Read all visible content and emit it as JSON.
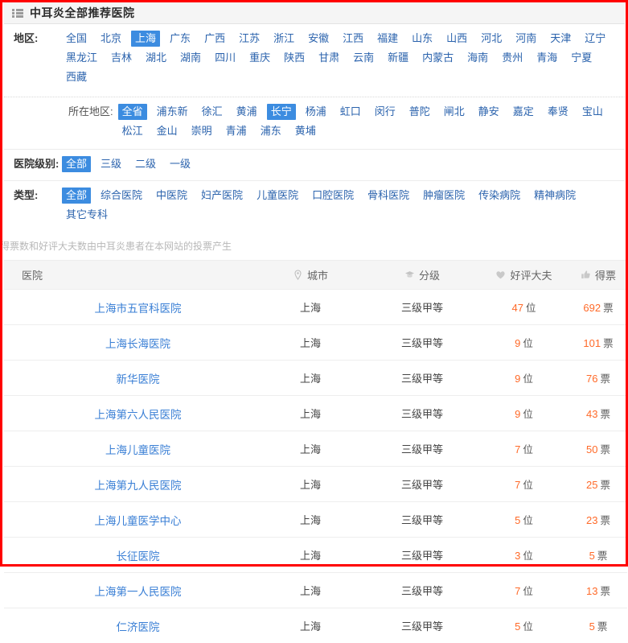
{
  "header": {
    "title": "中耳炎全部推荐医院",
    "icon": "list-icon"
  },
  "filters": {
    "region": {
      "label": "地区:",
      "options": [
        {
          "text": "全国",
          "active": false
        },
        {
          "text": "北京",
          "active": false
        },
        {
          "text": "上海",
          "active": true
        },
        {
          "text": "广东",
          "active": false
        },
        {
          "text": "广西",
          "active": false
        },
        {
          "text": "江苏",
          "active": false
        },
        {
          "text": "浙江",
          "active": false
        },
        {
          "text": "安徽",
          "active": false
        },
        {
          "text": "江西",
          "active": false
        },
        {
          "text": "福建",
          "active": false
        },
        {
          "text": "山东",
          "active": false
        },
        {
          "text": "山西",
          "active": false
        },
        {
          "text": "河北",
          "active": false
        },
        {
          "text": "河南",
          "active": false
        },
        {
          "text": "天津",
          "active": false
        },
        {
          "text": "辽宁",
          "active": false
        },
        {
          "text": "黑龙江",
          "active": false
        },
        {
          "text": "吉林",
          "active": false
        },
        {
          "text": "湖北",
          "active": false
        },
        {
          "text": "湖南",
          "active": false
        },
        {
          "text": "四川",
          "active": false
        },
        {
          "text": "重庆",
          "active": false
        },
        {
          "text": "陕西",
          "active": false
        },
        {
          "text": "甘肃",
          "active": false
        },
        {
          "text": "云南",
          "active": false
        },
        {
          "text": "新疆",
          "active": false
        },
        {
          "text": "内蒙古",
          "active": false
        },
        {
          "text": "海南",
          "active": false
        },
        {
          "text": "贵州",
          "active": false
        },
        {
          "text": "青海",
          "active": false
        },
        {
          "text": "宁夏",
          "active": false
        },
        {
          "text": "西藏",
          "active": false
        }
      ]
    },
    "district": {
      "label": "所在地区:",
      "options": [
        {
          "text": "全省",
          "active": true
        },
        {
          "text": "浦东新",
          "active": false
        },
        {
          "text": "徐汇",
          "active": false
        },
        {
          "text": "黄浦",
          "active": false
        },
        {
          "text": "长宁",
          "active": true
        },
        {
          "text": "杨浦",
          "active": false
        },
        {
          "text": "虹口",
          "active": false
        },
        {
          "text": "闵行",
          "active": false
        },
        {
          "text": "普陀",
          "active": false
        },
        {
          "text": "闸北",
          "active": false
        },
        {
          "text": "静安",
          "active": false
        },
        {
          "text": "嘉定",
          "active": false
        },
        {
          "text": "奉贤",
          "active": false
        },
        {
          "text": "宝山",
          "active": false
        },
        {
          "text": "松江",
          "active": false
        },
        {
          "text": "金山",
          "active": false
        },
        {
          "text": "崇明",
          "active": false
        },
        {
          "text": "青浦",
          "active": false
        },
        {
          "text": "浦东",
          "active": false
        },
        {
          "text": "黄埔",
          "active": false
        }
      ]
    },
    "level": {
      "label": "医院级别:",
      "options": [
        {
          "text": "全部",
          "active": true
        },
        {
          "text": "三级",
          "active": false
        },
        {
          "text": "二级",
          "active": false
        },
        {
          "text": "一级",
          "active": false
        }
      ]
    },
    "type": {
      "label": "类型:",
      "options": [
        {
          "text": "全部",
          "active": true
        },
        {
          "text": "综合医院",
          "active": false
        },
        {
          "text": "中医院",
          "active": false
        },
        {
          "text": "妇产医院",
          "active": false
        },
        {
          "text": "儿童医院",
          "active": false
        },
        {
          "text": "口腔医院",
          "active": false
        },
        {
          "text": "骨科医院",
          "active": false
        },
        {
          "text": "肿瘤医院",
          "active": false
        },
        {
          "text": "传染病院",
          "active": false
        },
        {
          "text": "精神病院",
          "active": false
        },
        {
          "text": "其它专科",
          "active": false
        }
      ]
    }
  },
  "hint": "得票数和好评大夫数由中耳炎患者在本网站的投票产生",
  "table": {
    "columns": [
      {
        "label": "医院",
        "icon": null
      },
      {
        "label": "城市",
        "icon": "location-pin-icon"
      },
      {
        "label": "分级",
        "icon": "graduation-cap-icon"
      },
      {
        "label": "好评大夫",
        "icon": "heart-icon"
      },
      {
        "label": "得票",
        "icon": "thumbs-up-icon"
      }
    ],
    "unit_doctors": "位",
    "unit_votes": "票",
    "rows": [
      {
        "name": "上海市五官科医院",
        "city": "上海",
        "level": "三级甲等",
        "doctors": "47",
        "votes": "692"
      },
      {
        "name": "上海长海医院",
        "city": "上海",
        "level": "三级甲等",
        "doctors": "9",
        "votes": "101"
      },
      {
        "name": "新华医院",
        "city": "上海",
        "level": "三级甲等",
        "doctors": "9",
        "votes": "76"
      },
      {
        "name": "上海第六人民医院",
        "city": "上海",
        "level": "三级甲等",
        "doctors": "9",
        "votes": "43"
      },
      {
        "name": "上海儿童医院",
        "city": "上海",
        "level": "三级甲等",
        "doctors": "7",
        "votes": "50"
      },
      {
        "name": "上海第九人民医院",
        "city": "上海",
        "level": "三级甲等",
        "doctors": "7",
        "votes": "25"
      },
      {
        "name": "上海儿童医学中心",
        "city": "上海",
        "level": "三级甲等",
        "doctors": "5",
        "votes": "23"
      },
      {
        "name": "长征医院",
        "city": "上海",
        "level": "三级甲等",
        "doctors": "3",
        "votes": "5"
      },
      {
        "name": "上海第一人民医院",
        "city": "上海",
        "level": "三级甲等",
        "doctors": "7",
        "votes": "13"
      },
      {
        "name": "仁济医院",
        "city": "上海",
        "level": "三级甲等",
        "doctors": "5",
        "votes": "5"
      }
    ]
  },
  "colors": {
    "accent_blue": "#3c8ce0",
    "link_blue": "#3a7fd5",
    "number_orange": "#ff6a29",
    "annotation_red": "#ff0000"
  }
}
